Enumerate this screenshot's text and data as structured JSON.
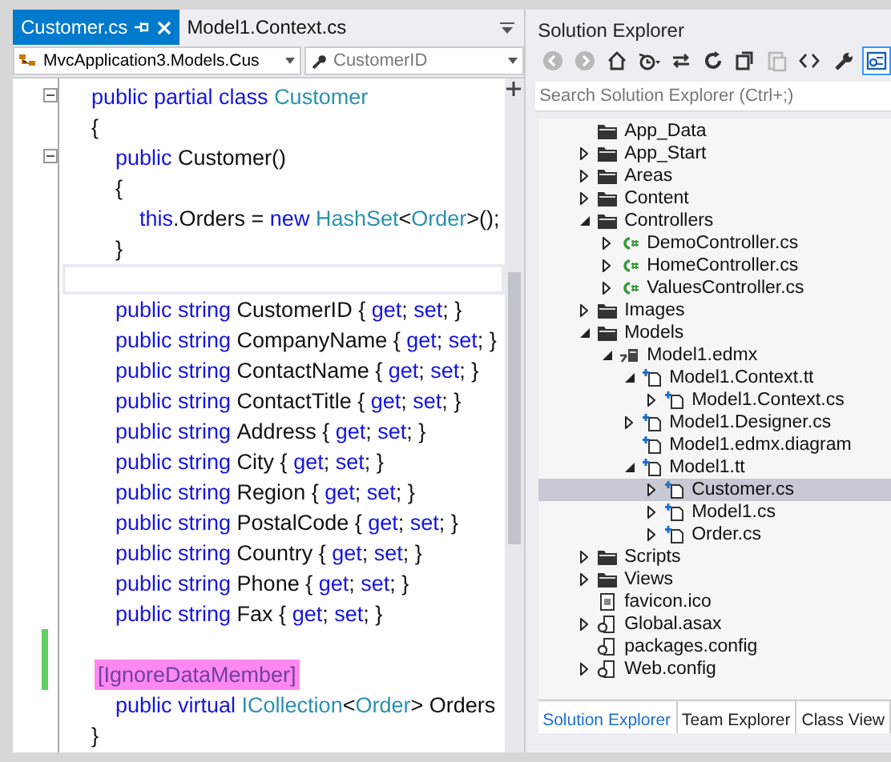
{
  "editor": {
    "tabs": [
      {
        "label": "Customer.cs",
        "selected": true
      },
      {
        "label": "Model1.Context.cs",
        "selected": false
      }
    ],
    "nav": {
      "type_box": "MvcApplication3.Models.Cus",
      "member_box": "CustomerID"
    },
    "lines": [
      {
        "fold": true,
        "tokens": [
          {
            "kind": "kw",
            "text": "public partial class "
          },
          {
            "kind": "type",
            "text": "Customer"
          }
        ]
      },
      {
        "tokens": [
          {
            "kind": "text",
            "text": "{"
          }
        ]
      },
      {
        "fold": true,
        "tokens": [
          {
            "kind": "kw",
            "text": "    public "
          },
          {
            "kind": "text",
            "text": "Customer()"
          }
        ]
      },
      {
        "tokens": [
          {
            "kind": "text",
            "text": "    {"
          }
        ]
      },
      {
        "tokens": [
          {
            "kind": "kw",
            "text": "        this"
          },
          {
            "kind": "text",
            "text": ".Orders = "
          },
          {
            "kind": "kw",
            "text": "new "
          },
          {
            "kind": "type",
            "text": "HashSet"
          },
          {
            "kind": "text",
            "text": "<"
          },
          {
            "kind": "type",
            "text": "Order"
          },
          {
            "kind": "text",
            "text": ">();"
          }
        ]
      },
      {
        "tokens": [
          {
            "kind": "text",
            "text": "    }"
          }
        ]
      },
      {
        "current": true
      },
      {
        "tokens": [
          {
            "kind": "kw",
            "text": "    public string "
          },
          {
            "kind": "text",
            "text": "CustomerID { "
          },
          {
            "kind": "kw",
            "text": "get"
          },
          {
            "kind": "text",
            "text": "; "
          },
          {
            "kind": "kw",
            "text": "set"
          },
          {
            "kind": "text",
            "text": "; }"
          }
        ]
      },
      {
        "tokens": [
          {
            "kind": "kw",
            "text": "    public string "
          },
          {
            "kind": "text",
            "text": "CompanyName { "
          },
          {
            "kind": "kw",
            "text": "get"
          },
          {
            "kind": "text",
            "text": "; "
          },
          {
            "kind": "kw",
            "text": "set"
          },
          {
            "kind": "text",
            "text": "; }"
          }
        ]
      },
      {
        "tokens": [
          {
            "kind": "kw",
            "text": "    public string "
          },
          {
            "kind": "text",
            "text": "ContactName { "
          },
          {
            "kind": "kw",
            "text": "get"
          },
          {
            "kind": "text",
            "text": "; "
          },
          {
            "kind": "kw",
            "text": "set"
          },
          {
            "kind": "text",
            "text": "; }"
          }
        ]
      },
      {
        "tokens": [
          {
            "kind": "kw",
            "text": "    public string "
          },
          {
            "kind": "text",
            "text": "ContactTitle { "
          },
          {
            "kind": "kw",
            "text": "get"
          },
          {
            "kind": "text",
            "text": "; "
          },
          {
            "kind": "kw",
            "text": "set"
          },
          {
            "kind": "text",
            "text": "; }"
          }
        ]
      },
      {
        "tokens": [
          {
            "kind": "kw",
            "text": "    public string "
          },
          {
            "kind": "text",
            "text": "Address { "
          },
          {
            "kind": "kw",
            "text": "get"
          },
          {
            "kind": "text",
            "text": "; "
          },
          {
            "kind": "kw",
            "text": "set"
          },
          {
            "kind": "text",
            "text": "; }"
          }
        ]
      },
      {
        "tokens": [
          {
            "kind": "kw",
            "text": "    public string "
          },
          {
            "kind": "text",
            "text": "City { "
          },
          {
            "kind": "kw",
            "text": "get"
          },
          {
            "kind": "text",
            "text": "; "
          },
          {
            "kind": "kw",
            "text": "set"
          },
          {
            "kind": "text",
            "text": "; }"
          }
        ]
      },
      {
        "tokens": [
          {
            "kind": "kw",
            "text": "    public string "
          },
          {
            "kind": "text",
            "text": "Region { "
          },
          {
            "kind": "kw",
            "text": "get"
          },
          {
            "kind": "text",
            "text": "; "
          },
          {
            "kind": "kw",
            "text": "set"
          },
          {
            "kind": "text",
            "text": "; }"
          }
        ]
      },
      {
        "tokens": [
          {
            "kind": "kw",
            "text": "    public string "
          },
          {
            "kind": "text",
            "text": "PostalCode { "
          },
          {
            "kind": "kw",
            "text": "get"
          },
          {
            "kind": "text",
            "text": "; "
          },
          {
            "kind": "kw",
            "text": "set"
          },
          {
            "kind": "text",
            "text": "; }"
          }
        ]
      },
      {
        "tokens": [
          {
            "kind": "kw",
            "text": "    public string "
          },
          {
            "kind": "text",
            "text": "Country { "
          },
          {
            "kind": "kw",
            "text": "get"
          },
          {
            "kind": "text",
            "text": "; "
          },
          {
            "kind": "kw",
            "text": "set"
          },
          {
            "kind": "text",
            "text": "; }"
          }
        ]
      },
      {
        "tokens": [
          {
            "kind": "kw",
            "text": "    public string "
          },
          {
            "kind": "text",
            "text": "Phone { "
          },
          {
            "kind": "kw",
            "text": "get"
          },
          {
            "kind": "text",
            "text": "; "
          },
          {
            "kind": "kw",
            "text": "set"
          },
          {
            "kind": "text",
            "text": "; }"
          }
        ]
      },
      {
        "tokens": [
          {
            "kind": "kw",
            "text": "    public string "
          },
          {
            "kind": "text",
            "text": "Fax { "
          },
          {
            "kind": "kw",
            "text": "get"
          },
          {
            "kind": "text",
            "text": "; "
          },
          {
            "kind": "kw",
            "text": "set"
          },
          {
            "kind": "text",
            "text": "; }"
          }
        ]
      },
      {
        "changed": true
      },
      {
        "changed": true,
        "tokens": [
          {
            "kind": "attr",
            "text": "[IgnoreDataMember]"
          }
        ]
      },
      {
        "tokens": [
          {
            "kind": "kw",
            "text": "    public virtual "
          },
          {
            "kind": "type",
            "text": "ICollection"
          },
          {
            "kind": "text",
            "text": "<"
          },
          {
            "kind": "type",
            "text": "Order"
          },
          {
            "kind": "text",
            "text": "> Orders"
          }
        ]
      },
      {
        "tokens": [
          {
            "kind": "text",
            "text": "}"
          }
        ]
      }
    ]
  },
  "solution_explorer": {
    "title": "Solution Explorer",
    "toolbar": [
      {
        "kind": "back",
        "disabled": true
      },
      {
        "kind": "forward",
        "disabled": true
      },
      {
        "kind": "home",
        "disabled": false
      },
      {
        "kind": "history",
        "disabled": false
      },
      {
        "kind": "sync",
        "disabled": false
      },
      {
        "kind": "refresh",
        "disabled": false
      },
      {
        "kind": "collapse",
        "disabled": false
      },
      {
        "kind": "properties",
        "disabled": true
      },
      {
        "kind": "code",
        "disabled": false
      },
      {
        "kind": "wrench",
        "disabled": false
      },
      {
        "kind": "preview",
        "disabled": false
      }
    ],
    "search": {
      "placeholder": "Search Solution Explorer (Ctrl+;)"
    },
    "tree": [
      {
        "label": "App_Data",
        "kind": "folder",
        "selected": false
      },
      {
        "label": "App_Start",
        "kind": "folder",
        "expanded": false,
        "selected": false
      },
      {
        "label": "Areas",
        "kind": "folder",
        "expanded": false,
        "selected": false
      },
      {
        "label": "Content",
        "kind": "folder",
        "expanded": false,
        "selected": false
      },
      {
        "label": "Controllers",
        "kind": "folder",
        "expanded": true,
        "selected": false,
        "children": [
          {
            "label": "DemoController.cs",
            "kind": "csharp",
            "expanded": false,
            "selected": false
          },
          {
            "label": "HomeController.cs",
            "kind": "csharp",
            "expanded": false,
            "selected": false
          },
          {
            "label": "ValuesController.cs",
            "kind": "csharp",
            "expanded": false,
            "selected": false
          }
        ]
      },
      {
        "label": "Images",
        "kind": "folder",
        "expanded": false,
        "selected": false
      },
      {
        "label": "Models",
        "kind": "folder",
        "expanded": true,
        "selected": false,
        "children": [
          {
            "label": "Model1.edmx",
            "kind": "model",
            "expanded": true,
            "selected": false,
            "children": [
              {
                "label": "Model1.Context.tt",
                "kind": "generated",
                "expanded": true,
                "selected": false,
                "children": [
                  {
                    "label": "Model1.Context.cs",
                    "kind": "generated",
                    "expanded": false,
                    "selected": false
                  }
                ]
              },
              {
                "label": "Model1.Designer.cs",
                "kind": "generated",
                "expanded": false,
                "selected": false
              },
              {
                "label": "Model1.edmx.diagram",
                "kind": "generated",
                "selected": false
              },
              {
                "label": "Model1.tt",
                "kind": "generated",
                "expanded": true,
                "selected": false,
                "children": [
                  {
                    "label": "Customer.cs",
                    "kind": "generated",
                    "expanded": false,
                    "selected": true
                  },
                  {
                    "label": "Model1.cs",
                    "kind": "generated",
                    "expanded": false,
                    "selected": false
                  },
                  {
                    "label": "Order.cs",
                    "kind": "generated",
                    "expanded": false,
                    "selected": false
                  }
                ]
              }
            ]
          }
        ]
      },
      {
        "label": "Scripts",
        "kind": "folder",
        "expanded": false,
        "selected": false
      },
      {
        "label": "Views",
        "kind": "folder",
        "expanded": false,
        "selected": false
      },
      {
        "label": "favicon.ico",
        "kind": "image",
        "selected": false
      },
      {
        "label": "Global.asax",
        "kind": "config",
        "expanded": false,
        "selected": false
      },
      {
        "label": "packages.config",
        "kind": "config",
        "selected": false
      },
      {
        "label": "Web.config",
        "kind": "config",
        "expanded": false,
        "selected": false
      }
    ],
    "bottom_tabs": [
      {
        "label": "Solution Explorer",
        "selected": true
      },
      {
        "label": "Team Explorer",
        "selected": false
      },
      {
        "label": "Class View",
        "selected": false
      }
    ]
  }
}
